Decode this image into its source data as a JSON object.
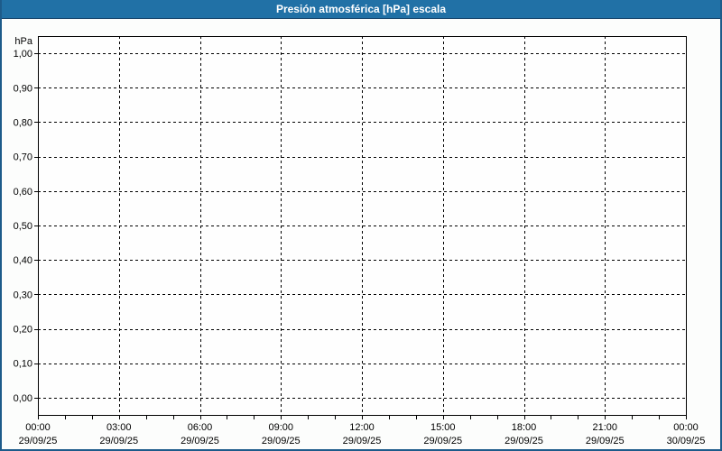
{
  "window": {
    "title": "Presión atmosférica [hPa] escala"
  },
  "colors": {
    "titlebar": "#2171a6",
    "titlebar_border": "#17446b",
    "frame_border": "#1d5b8a",
    "background": "#fcfdfc",
    "plot_background": "#fefefe",
    "grid": "#000000",
    "axis": "#000000",
    "text": "#000000",
    "title_text": "#ffffff"
  },
  "chart_data": {
    "type": "line",
    "title": "Presión atmosférica [hPa] escala",
    "ylabel": "hPa",
    "xlabel": "",
    "ylim": [
      -0.05,
      1.05
    ],
    "xlim_hours": [
      0,
      24
    ],
    "grid": "dashed",
    "legend": "none",
    "minor_x_tick_hours": 1,
    "y_ticks": [
      {
        "value": 1.0,
        "label": "1,00"
      },
      {
        "value": 0.9,
        "label": "0,90"
      },
      {
        "value": 0.8,
        "label": "0,80"
      },
      {
        "value": 0.7,
        "label": "0,70"
      },
      {
        "value": 0.6,
        "label": "0,60"
      },
      {
        "value": 0.5,
        "label": "0,50"
      },
      {
        "value": 0.4,
        "label": "0,40"
      },
      {
        "value": 0.3,
        "label": "0,30"
      },
      {
        "value": 0.2,
        "label": "0,20"
      },
      {
        "value": 0.1,
        "label": "0,10"
      },
      {
        "value": 0.0,
        "label": "0,00"
      }
    ],
    "x_ticks": [
      {
        "hour": 0,
        "time": "00:00",
        "date": "29/09/25"
      },
      {
        "hour": 3,
        "time": "03:00",
        "date": "29/09/25"
      },
      {
        "hour": 6,
        "time": "06:00",
        "date": "29/09/25"
      },
      {
        "hour": 9,
        "time": "09:00",
        "date": "29/09/25"
      },
      {
        "hour": 12,
        "time": "12:00",
        "date": "29/09/25"
      },
      {
        "hour": 15,
        "time": "15:00",
        "date": "29/09/25"
      },
      {
        "hour": 18,
        "time": "18:00",
        "date": "29/09/25"
      },
      {
        "hour": 21,
        "time": "21:00",
        "date": "29/09/25"
      },
      {
        "hour": 24,
        "time": "00:00",
        "date": "30/09/25"
      }
    ],
    "series": []
  }
}
